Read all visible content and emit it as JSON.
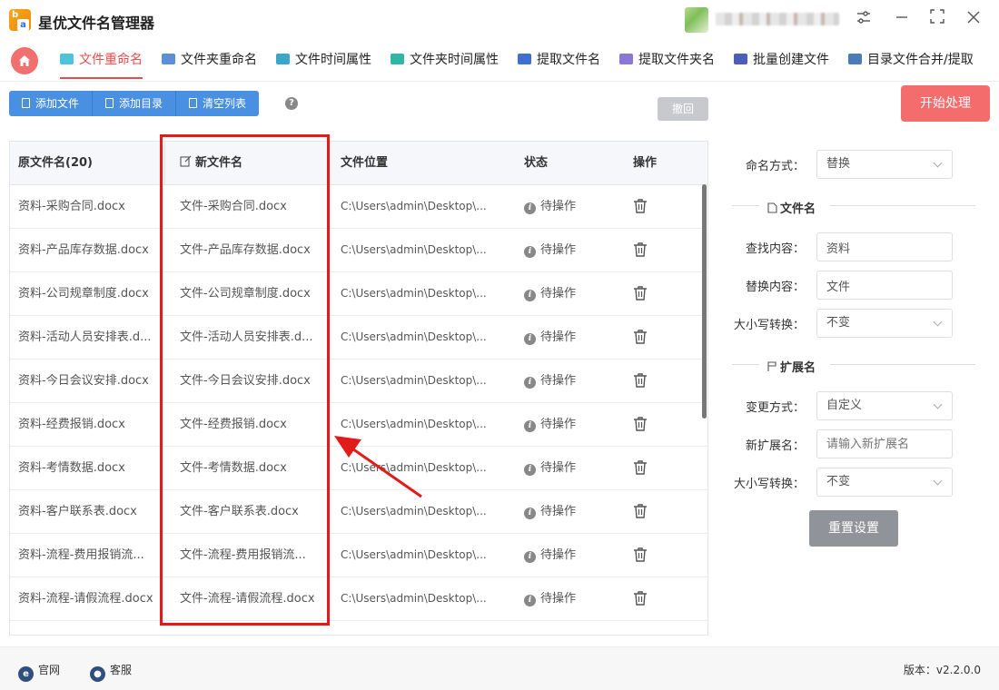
{
  "app": {
    "title": "星优文件名管理器"
  },
  "tabs": [
    {
      "label": "文件重命名",
      "active": true
    },
    {
      "label": "文件夹重命名"
    },
    {
      "label": "文件时间属性"
    },
    {
      "label": "文件夹时间属性"
    },
    {
      "label": "提取文件名"
    },
    {
      "label": "提取文件夹名"
    },
    {
      "label": "批量创建文件"
    },
    {
      "label": "目录文件合并/提取"
    }
  ],
  "toolbar": {
    "add_file": "添加文件",
    "add_dir": "添加目录",
    "clear_list": "清空列表",
    "undo": "撤回",
    "start": "开始处理"
  },
  "table": {
    "headers": {
      "original": "原文件名(20)",
      "new": "新文件名",
      "location": "文件位置",
      "status": "状态",
      "action": "操作"
    },
    "rows": [
      {
        "original": "资料-采购合同.docx",
        "new": "文件-采购合同.docx",
        "location": "C:\\Users\\admin\\Desktop\\...",
        "status": "待操作"
      },
      {
        "original": "资料-产品库存数据.docx",
        "new": "文件-产品库存数据.docx",
        "location": "C:\\Users\\admin\\Desktop\\...",
        "status": "待操作"
      },
      {
        "original": "资料-公司规章制度.docx",
        "new": "文件-公司规章制度.docx",
        "location": "C:\\Users\\admin\\Desktop\\...",
        "status": "待操作"
      },
      {
        "original": "资料-活动人员安排表.d...",
        "new": "文件-活动人员安排表.d...",
        "location": "C:\\Users\\admin\\Desktop\\...",
        "status": "待操作"
      },
      {
        "original": "资料-今日会议安排.docx",
        "new": "文件-今日会议安排.docx",
        "location": "C:\\Users\\admin\\Desktop\\...",
        "status": "待操作"
      },
      {
        "original": "资料-经费报销.docx",
        "new": "文件-经费报销.docx",
        "location": "C:\\Users\\admin\\Desktop\\...",
        "status": "待操作"
      },
      {
        "original": "资料-考情数据.docx",
        "new": "文件-考情数据.docx",
        "location": "C:\\Users\\admin\\Desktop\\...",
        "status": "待操作"
      },
      {
        "original": "资料-客户联系表.docx",
        "new": "文件-客户联系表.docx",
        "location": "C:\\Users\\admin\\Desktop\\...",
        "status": "待操作"
      },
      {
        "original": "资料-流程-费用报销流...",
        "new": "文件-流程-费用报销流...",
        "location": "C:\\Users\\admin\\Desktop\\...",
        "status": "待操作"
      },
      {
        "original": "资料-流程-请假流程.docx",
        "new": "文件-流程-请假流程.docx",
        "location": "C:\\Users\\admin\\Desktop\\...",
        "status": "待操作"
      }
    ]
  },
  "settings": {
    "naming_label": "命名方式：",
    "naming_value": "替换",
    "filename_section": "文件名",
    "find_label": "查找内容：",
    "find_value": "资料",
    "replace_label": "替换内容：",
    "replace_value": "文件",
    "case_label": "大小写转换：",
    "case_value": "不变",
    "ext_section": "扩展名",
    "change_label": "变更方式：",
    "change_value": "自定义",
    "newext_label": "新扩展名：",
    "newext_placeholder": "请输入新扩展名",
    "case2_label": "大小写转换：",
    "case2_value": "不变",
    "reset": "重置设置"
  },
  "footer": {
    "website": "官网",
    "support": "客服",
    "version": "版本：v2.2.0.0"
  },
  "colors": {
    "accent_red": "#e64c4c",
    "primary_blue": "#4a90e2",
    "start_button": "#f56c6c",
    "highlight": "#e21a1a"
  }
}
